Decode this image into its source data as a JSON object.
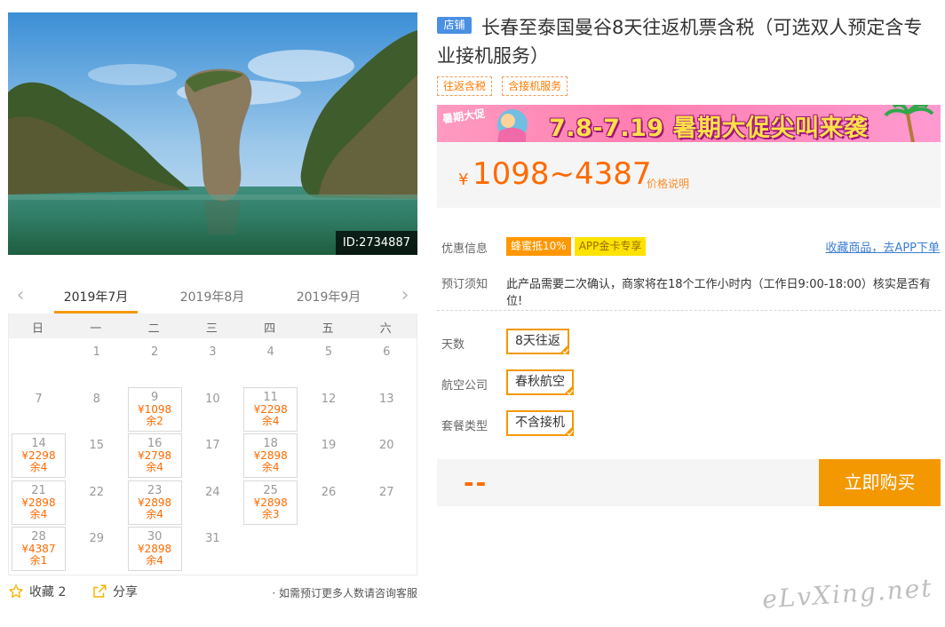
{
  "hero": {
    "id_label": "ID:2734887"
  },
  "calendar": {
    "prev_icon": "chevron-left-icon",
    "next_icon": "chevron-right-icon",
    "months": [
      "2019年7月",
      "2019年8月",
      "2019年9月"
    ],
    "active_month": 0,
    "weekdays": [
      "日",
      "一",
      "二",
      "三",
      "四",
      "五",
      "六"
    ],
    "first_weekday": 1,
    "days": [
      {
        "d": "1"
      },
      {
        "d": "2"
      },
      {
        "d": "3"
      },
      {
        "d": "4"
      },
      {
        "d": "5"
      },
      {
        "d": "6"
      },
      {
        "d": "7"
      },
      {
        "d": "8"
      },
      {
        "d": "9",
        "price": "¥1098",
        "stock": "余2"
      },
      {
        "d": "10"
      },
      {
        "d": "11",
        "price": "¥2298",
        "stock": "余4"
      },
      {
        "d": "12"
      },
      {
        "d": "13"
      },
      {
        "d": "14",
        "price": "¥2298",
        "stock": "余4"
      },
      {
        "d": "15"
      },
      {
        "d": "16",
        "price": "¥2798",
        "stock": "余4"
      },
      {
        "d": "17"
      },
      {
        "d": "18",
        "price": "¥2898",
        "stock": "余4"
      },
      {
        "d": "19"
      },
      {
        "d": "20"
      },
      {
        "d": "21",
        "price": "¥2898",
        "stock": "余4"
      },
      {
        "d": "22"
      },
      {
        "d": "23",
        "price": "¥2898",
        "stock": "余4"
      },
      {
        "d": "24"
      },
      {
        "d": "25",
        "price": "¥2898",
        "stock": "余3"
      },
      {
        "d": "26"
      },
      {
        "d": "27"
      },
      {
        "d": "28",
        "price": "¥4387",
        "stock": "余1"
      },
      {
        "d": "29"
      },
      {
        "d": "30",
        "price": "¥2898",
        "stock": "余4"
      },
      {
        "d": "31"
      }
    ]
  },
  "actions": {
    "favorite_label": "收藏 2",
    "favorite_icon": "star-icon",
    "share_label": "分享",
    "share_icon": "share-icon",
    "consult_note": "· 如需预订更多人数请咨询客服"
  },
  "product": {
    "shop_badge": "店铺",
    "title": "长春至泰国曼谷8天往返机票含税（可选双人预定含专业接机服务）",
    "tags": [
      "往返含税",
      "含接机服务"
    ]
  },
  "promo": {
    "label": "暑期大促",
    "text": "7.8-7.19 暑期大促尖叫来袭"
  },
  "price": {
    "currency": "¥",
    "range": "1098~4387",
    "note": "价格说明"
  },
  "offers": {
    "label": "优惠信息",
    "badges": [
      "蜂蜜抵10%",
      "APP金卡专享"
    ],
    "favorite_app_link": "收藏商品，去APP下单"
  },
  "notice": {
    "label": "预订须知",
    "text": "此产品需要二次确认，商家将在18个工作小时内（工作日9:00-18:00）核实是否有位!"
  },
  "options": [
    {
      "label": "天数",
      "value": "8天往返"
    },
    {
      "label": "航空公司",
      "value": "春秋航空"
    },
    {
      "label": "套餐类型",
      "value": "不含接机"
    }
  ],
  "purchase": {
    "total": "--",
    "buy_label": "立即购买"
  },
  "watermark": "eLvXing.net",
  "colors": {
    "accent": "#f39800",
    "price": "#ff6a00",
    "link": "#3b7ed1"
  }
}
